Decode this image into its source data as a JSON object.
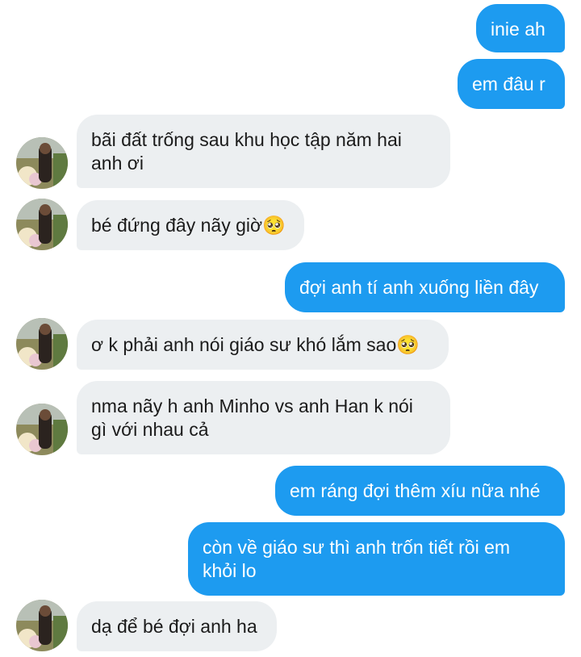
{
  "messages": [
    {
      "side": "sent",
      "text": "inie ah"
    },
    {
      "side": "sent",
      "text": "em đâu r"
    },
    {
      "side": "received",
      "text": "bãi đất trống sau khu học tập năm hai\nanh ơi",
      "avatar_icon": "profile-photo-icon"
    },
    {
      "side": "received",
      "text": "bé đứng đây nãy giờ🥺",
      "avatar_icon": "profile-photo-icon"
    },
    {
      "side": "sent",
      "text": "đợi anh tí anh xuống liền đây"
    },
    {
      "side": "received",
      "text": "ơ k phải anh nói giáo sư khó lắm sao🥺",
      "avatar_icon": "profile-photo-icon"
    },
    {
      "side": "received",
      "text": "nma nãy h anh Minho vs anh Han k nói\ngì với nhau cả",
      "avatar_icon": "profile-photo-icon"
    },
    {
      "side": "sent",
      "text": "em ráng đợi thêm xíu nữa nhé"
    },
    {
      "side": "sent",
      "text": "còn về giáo sư thì anh trốn tiết rồi em\nkhỏi lo"
    },
    {
      "side": "received",
      "text": "dạ để bé đợi anh ha",
      "avatar_icon": "profile-photo-icon"
    }
  ],
  "colors": {
    "sent_bubble": "#1d9bf0",
    "received_bubble": "#eceff1",
    "background": "#ffffff"
  }
}
